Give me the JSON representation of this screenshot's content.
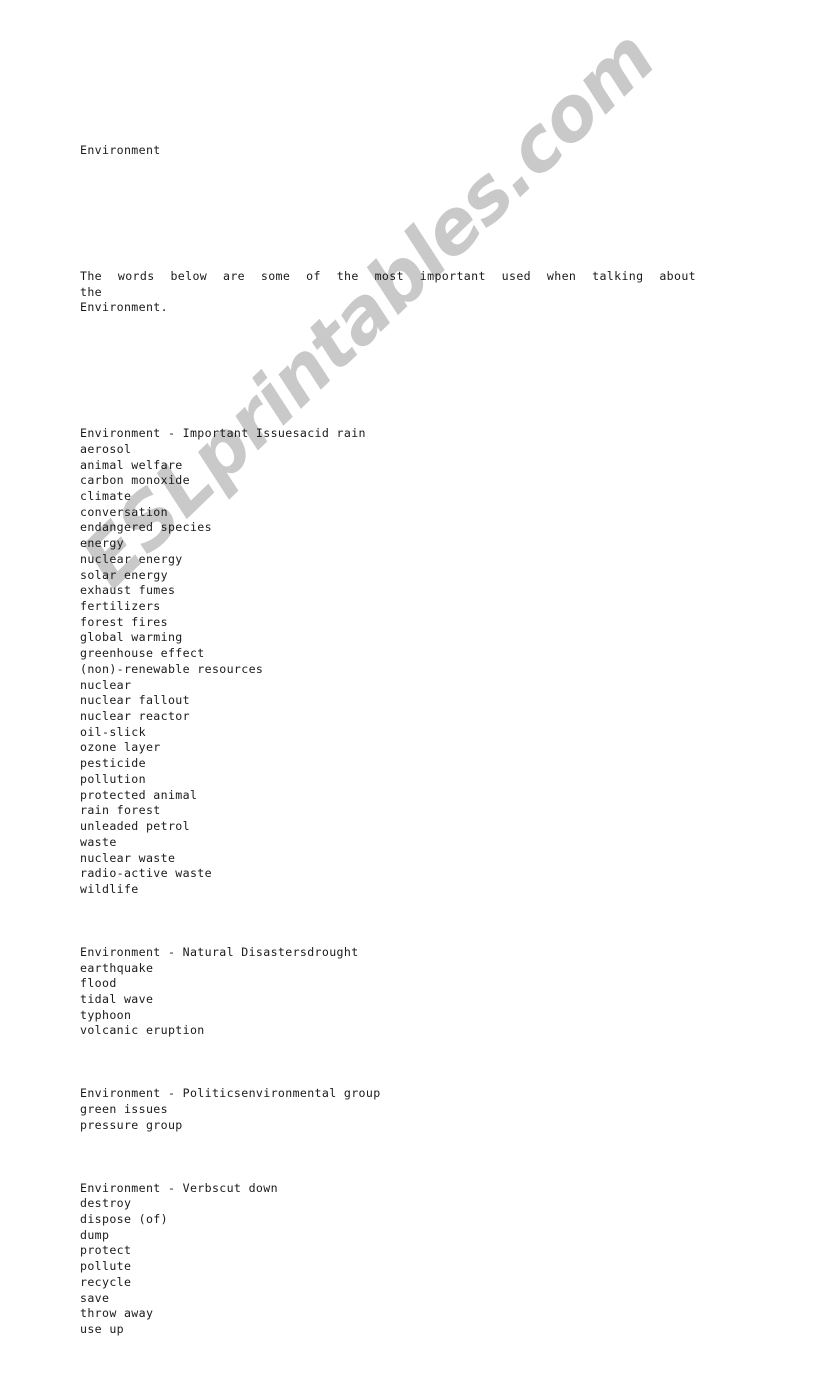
{
  "document": {
    "title": "Environment",
    "intro": "The  words  below  are  some  of  the  most  important  used  when  talking  about  the\nEnvironment.",
    "watermark": {
      "text": "ESLprintables.com",
      "color": "#c9c9c9"
    },
    "sections": [
      {
        "heading": "Environment - Important Issuesacid rain",
        "items": [
          "aerosol",
          "animal welfare",
          "carbon monoxide",
          "climate",
          "conversation",
          "endangered species",
          "energy",
          "nuclear energy",
          "solar energy",
          "exhaust fumes",
          "fertilizers",
          "forest fires",
          "global warming",
          "greenhouse effect",
          "(non)-renewable resources",
          "nuclear",
          "nuclear fallout",
          "nuclear reactor",
          "oil-slick",
          "ozone layer",
          "pesticide",
          "pollution",
          "protected animal",
          "rain forest",
          "unleaded petrol",
          "waste",
          "nuclear waste",
          "radio-active waste",
          "wildlife"
        ]
      },
      {
        "heading": "Environment - Natural Disastersdrought",
        "items": [
          "earthquake",
          "flood",
          "tidal wave",
          "typhoon",
          "volcanic eruption"
        ]
      },
      {
        "heading": "Environment - Politicsenvironmental group",
        "items": [
          "green issues",
          "pressure group"
        ]
      },
      {
        "heading": "Environment - Verbscut down",
        "items": [
          "destroy",
          "dispose (of)",
          "dump",
          "protect",
          "pollute",
          "recycle",
          "save",
          "throw away",
          "use up"
        ]
      }
    ]
  }
}
